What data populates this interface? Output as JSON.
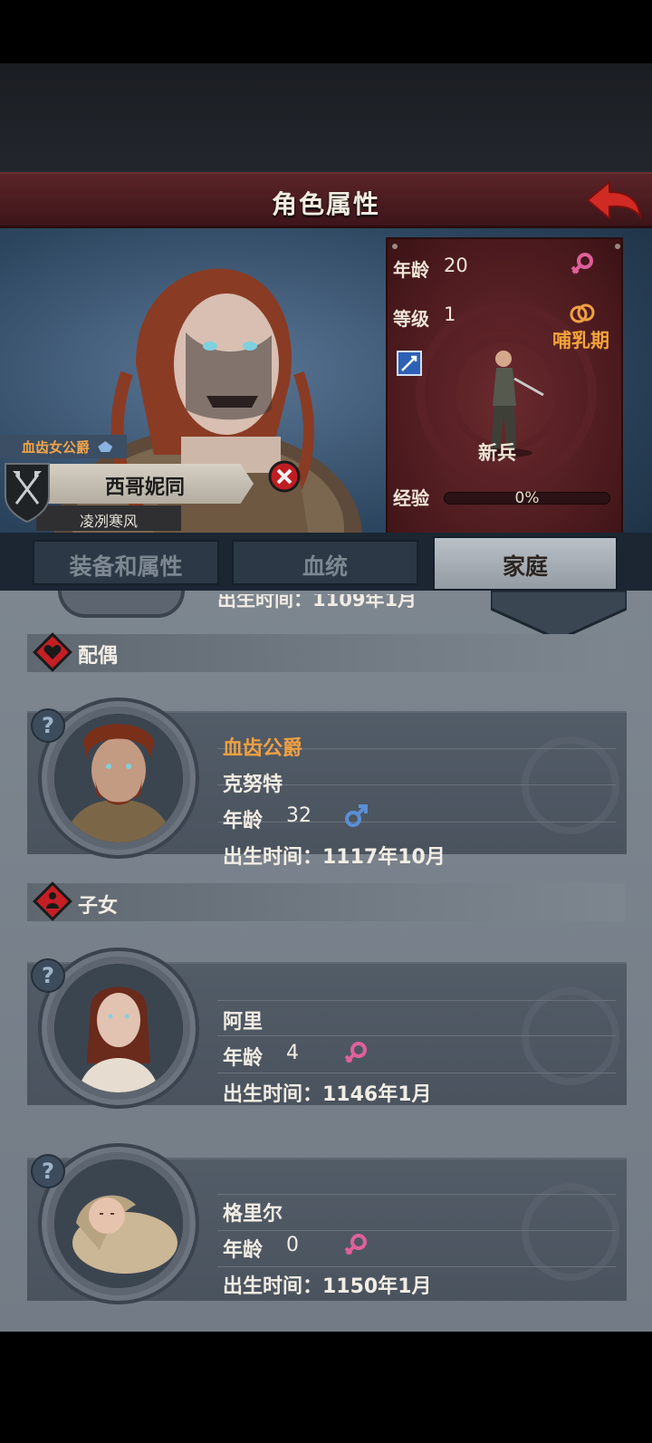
{
  "header": {
    "title": "角色属性"
  },
  "character": {
    "title": "血齿女公爵",
    "name": "西哥妮同",
    "subtitle": "凌冽寒风",
    "age_label": "年龄",
    "age": "20",
    "level_label": "等级",
    "level": "1",
    "status": "哺乳期",
    "rank": "新兵",
    "exp_label": "经验",
    "exp_percent": "0%"
  },
  "tabs": [
    {
      "label": "装备和属性"
    },
    {
      "label": "血统"
    },
    {
      "label": "家庭"
    }
  ],
  "family": {
    "cut_birth_text": "出生时间：1109年1月",
    "spouse_section": "配偶",
    "children_section": "子女",
    "spouse": {
      "title": "血齿公爵",
      "name": "克努特",
      "age_label": "年龄",
      "age": "32",
      "birth": "出生时间：1117年10月"
    },
    "children": [
      {
        "name": "阿里",
        "age_label": "年龄",
        "age": "4",
        "birth": "出生时间：1146年1月"
      },
      {
        "name": "格里尔",
        "age_label": "年龄",
        "age": "0",
        "birth": "出生时间：1150年1月"
      }
    ]
  },
  "colors": {
    "accent_orange": "#f0a043",
    "female_pink": "#e0609a",
    "male_blue": "#5b8fd6",
    "title_red": "#5a2428"
  }
}
